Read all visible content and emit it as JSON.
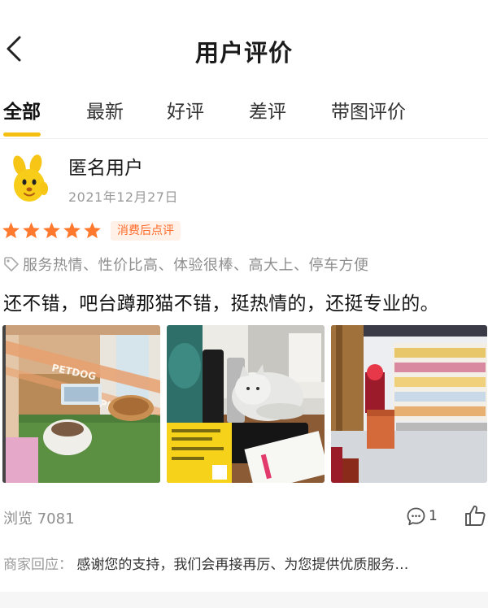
{
  "header": {
    "title": "用户评价"
  },
  "tabs": [
    {
      "label": "全部",
      "active": true
    },
    {
      "label": "最新",
      "active": false
    },
    {
      "label": "好评",
      "active": false
    },
    {
      "label": "差评",
      "active": false
    },
    {
      "label": "带图评价",
      "active": false
    }
  ],
  "review": {
    "user_name": "匿名用户",
    "date": "2021年12月27日",
    "rating": 5,
    "badge": "消费后点评",
    "tags": "服务热情、性价比高、体验很棒、高大上、停车方便",
    "text": "还不错，吧台蹲那猫不错，挺热情的，还挺专业的。",
    "photo_count": 3,
    "views": "浏览 7081",
    "comment_count": "1",
    "merchant_label": "商家回应：",
    "merchant_reply": "感谢您的支持，我们会再接再厉、为您提供优质服务…"
  },
  "photos": {
    "photo1_sign": "PETDOG"
  },
  "colors": {
    "accent": "#f5c012",
    "star": "#ff7a2f",
    "badge_text": "#ff6a28",
    "badge_bg": "#fff1e8"
  },
  "icons": [
    "back-arrow-icon",
    "tag-icon",
    "star-icon",
    "comment-icon",
    "thumbs-up-icon"
  ]
}
